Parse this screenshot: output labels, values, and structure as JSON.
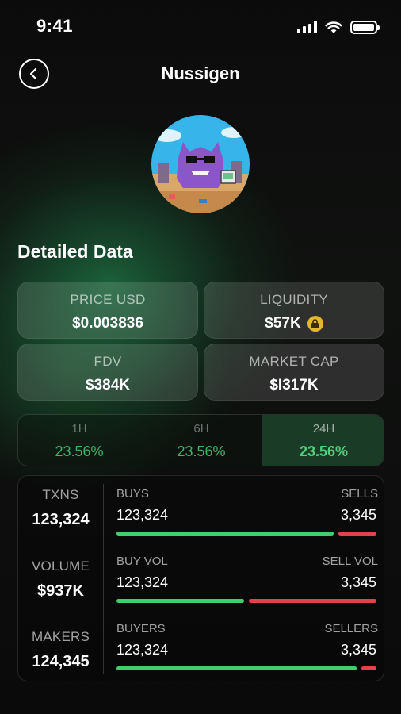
{
  "status": {
    "time": "9:41"
  },
  "header": {
    "title": "Nussigen"
  },
  "icons": {
    "back": "chevron-left-icon",
    "lock": "lock-icon",
    "signal": "cellular-signal-icon",
    "wifi": "wifi-icon",
    "battery": "battery-icon"
  },
  "colors": {
    "green": "#3fd06b",
    "red": "#e6404a",
    "lock": "#e5b72a",
    "accent": "#4fd17c"
  },
  "section": {
    "title": "Detailed Data"
  },
  "stats": {
    "price": {
      "label": "PRICE USD",
      "value": "$0.003836"
    },
    "liquidity": {
      "label": "LIQUIDITY",
      "value": "$57K"
    },
    "fdv": {
      "label": "FDV",
      "value": "$384K"
    },
    "market_cap": {
      "label": "MARKET CAP",
      "value": "$I317K"
    }
  },
  "timeframes": [
    {
      "label": "1H",
      "value": "23.56%"
    },
    {
      "label": "6H",
      "value": "23.56%"
    },
    {
      "label": "24H",
      "value": "23.56%"
    }
  ],
  "timeframe_selected": "24H",
  "txns": {
    "left": [
      {
        "label": "TXNS",
        "value": "123,324"
      },
      {
        "label": "VOLUME",
        "value": "$937K"
      },
      {
        "label": "MAKERS",
        "value": "124,345"
      }
    ],
    "rows": [
      {
        "left_label": "BUYS",
        "right_label": "SELLS",
        "left_value": "123,324",
        "right_value": "3,345",
        "buy_fraction": 0.85
      },
      {
        "left_label": "BUY VOL",
        "right_label": "SELL VOL",
        "left_value": "123,324",
        "right_value": "3,345",
        "buy_fraction": 0.5
      },
      {
        "left_label": "BUYERS",
        "right_label": "SELLERS",
        "left_value": "123,324",
        "right_value": "3,345",
        "buy_fraction": 0.94
      }
    ]
  }
}
